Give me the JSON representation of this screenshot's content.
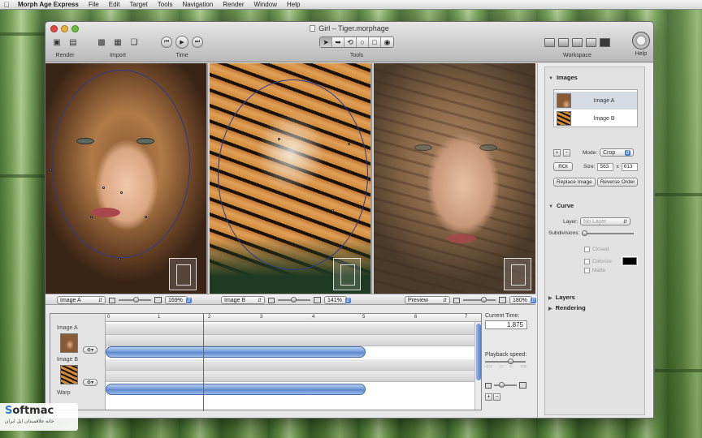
{
  "menubar": {
    "items": [
      "Morph Age Express",
      "File",
      "Edit",
      "Target",
      "Tools",
      "Navigation",
      "Render",
      "Window",
      "Help"
    ]
  },
  "window": {
    "title": "Girl – Tiger.morphage"
  },
  "toolbar": {
    "render_label": "Render",
    "import_label": "Import",
    "time_label": "Time",
    "tools_label": "Tools",
    "workspace_label": "Workspace",
    "help_label": "Help"
  },
  "panels": {
    "a": {
      "select": "Image A",
      "zoom": "169%"
    },
    "b": {
      "select": "Image B",
      "zoom": "141%"
    },
    "c": {
      "select": "Preview",
      "zoom": "180%"
    }
  },
  "timeline": {
    "ticks": [
      "0",
      "1",
      "2",
      "3",
      "4",
      "5",
      "6",
      "7"
    ],
    "tracks": [
      "Image A",
      "Image B",
      "Warp"
    ],
    "current_time_label": "Current Time:",
    "current_time_value": "1.875",
    "playback_speed_label": "Playback speed:"
  },
  "inspector": {
    "images_header": "Images",
    "image_list": [
      "Image A",
      "Image B"
    ],
    "mode_label": "Mode:",
    "mode_value": "Crop",
    "roi_label": "ROI",
    "size_label": "Size:",
    "size_w": "563",
    "size_x": "x",
    "size_h": "613",
    "replace_button": "Replace Image",
    "reverse_button": "Reverse Order",
    "curve_header": "Curve",
    "layer_label": "Layer:",
    "layer_value": "No Layer",
    "subdivisions_label": "Subdivisions:",
    "closed_label": "Closed",
    "colorize_label": "Colorize",
    "matte_label": "Matte",
    "layers_header": "Layers",
    "rendering_header": "Rendering"
  },
  "watermark": {
    "logo_a": "S",
    "logo_b": "oftmac",
    "subtitle": "خانه علاقمندان اپل ایران"
  },
  "colors": {
    "accent_blue": "#5a86cc",
    "window_bg": "#e8e8e8"
  }
}
